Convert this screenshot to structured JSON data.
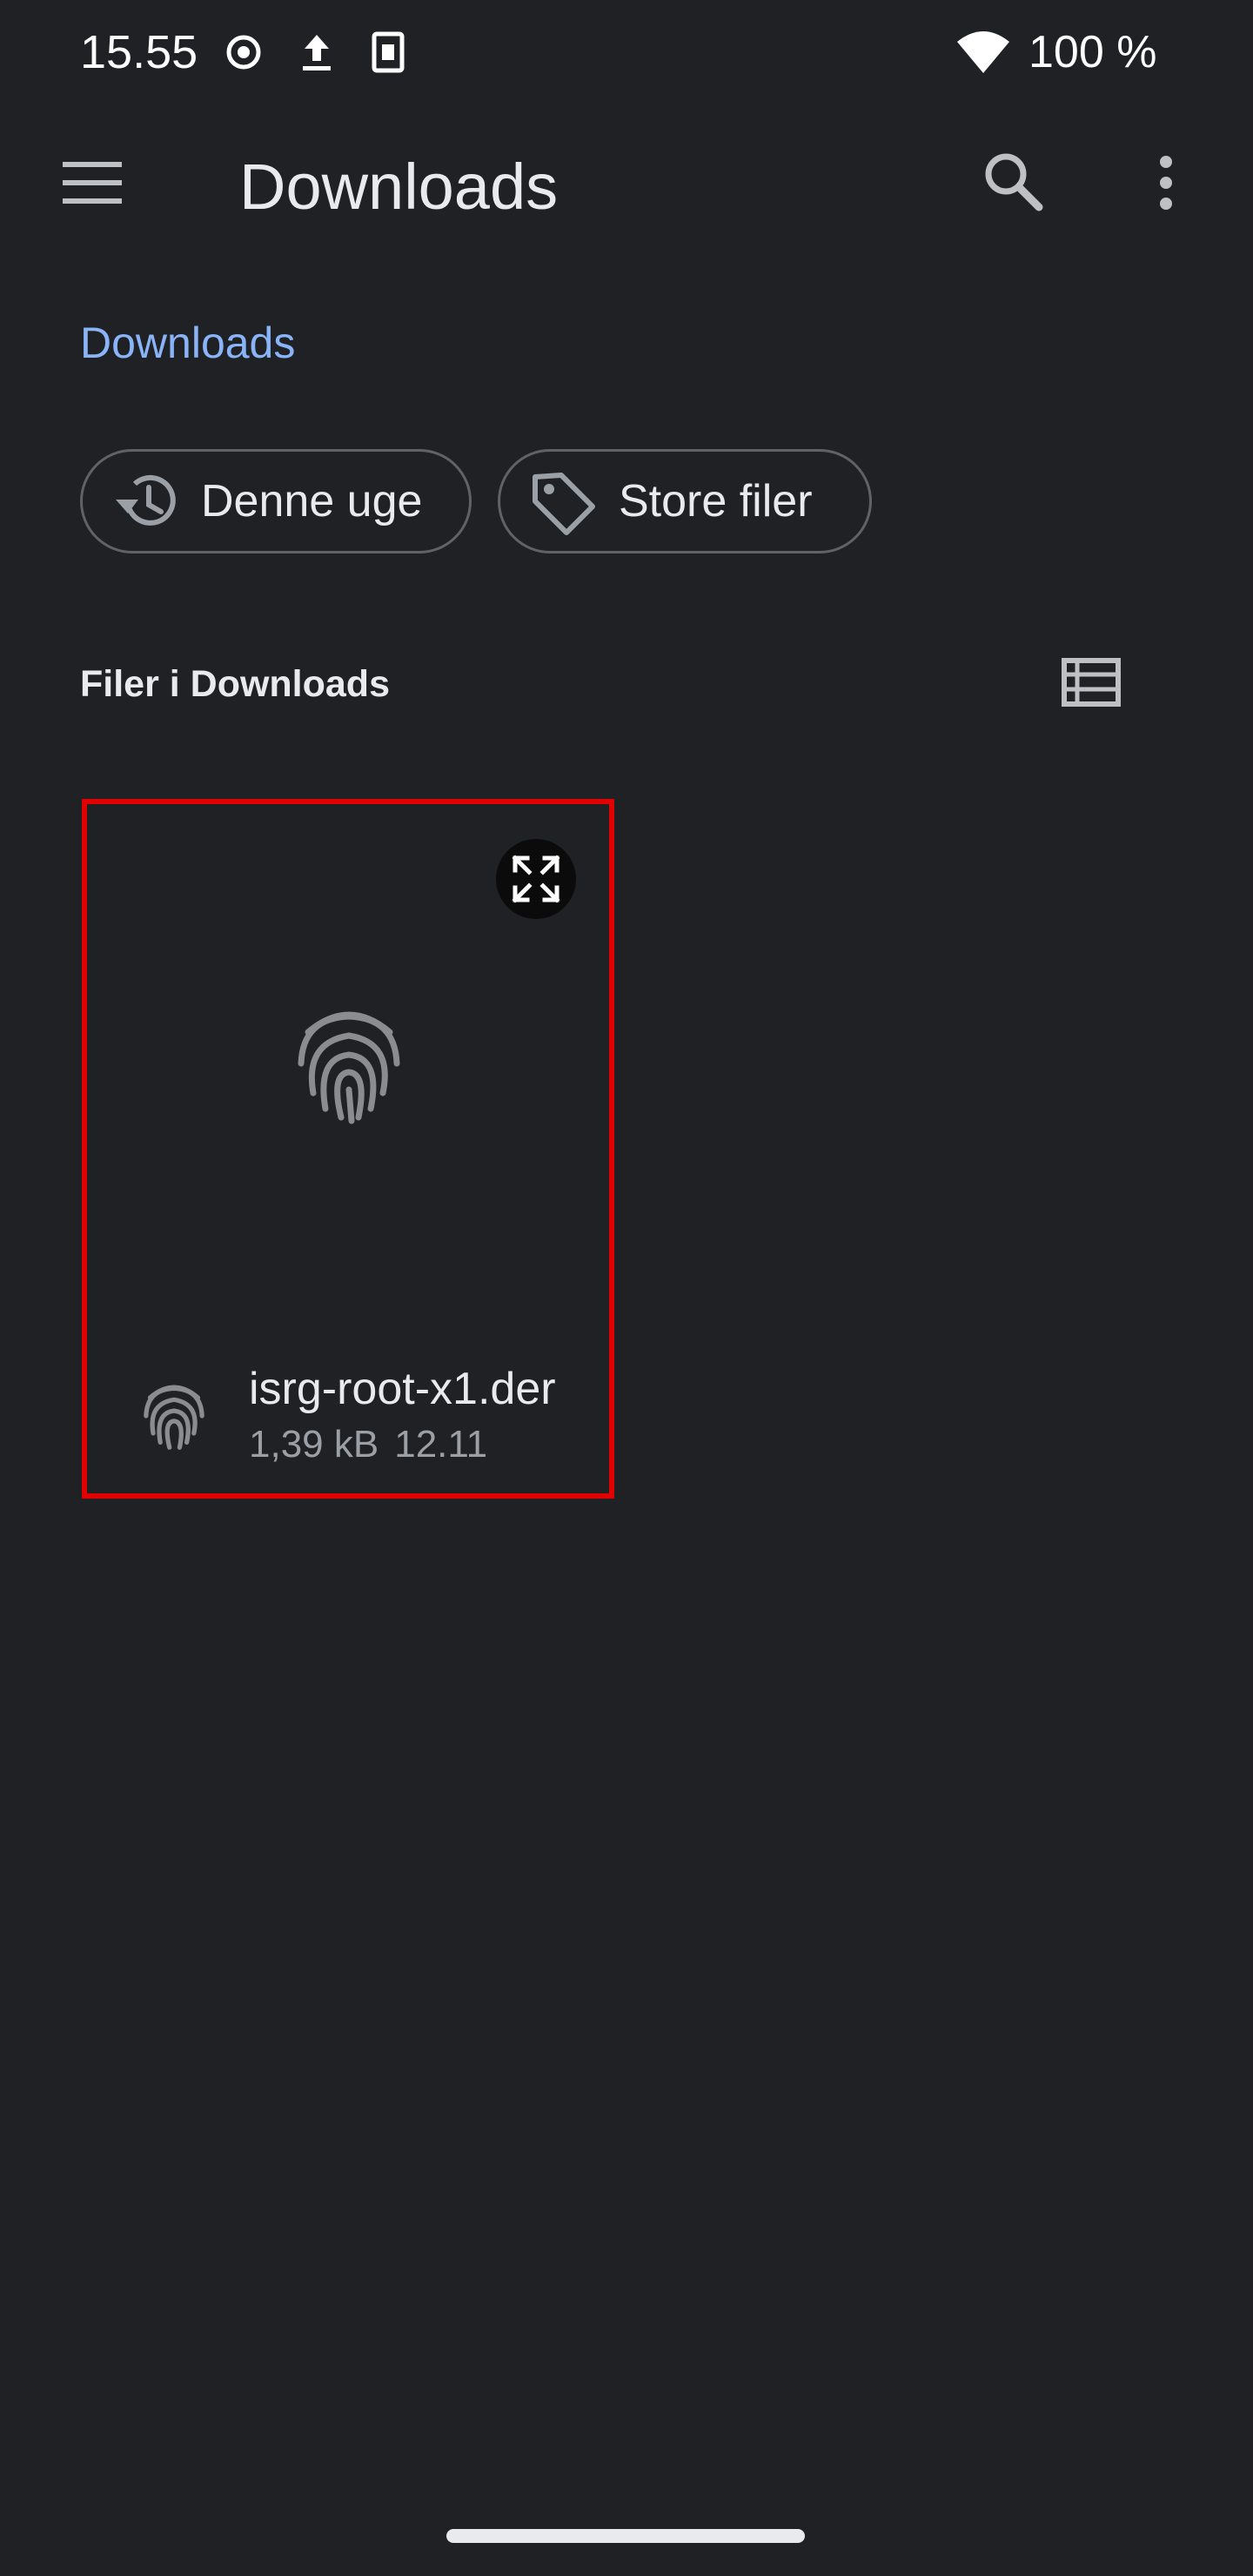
{
  "status_bar": {
    "time": "15.55",
    "battery": "100 %",
    "icons": [
      "record-icon",
      "upload-icon",
      "sim-card-icon",
      "wifi-icon"
    ]
  },
  "app_bar": {
    "title": "Downloads",
    "icons": [
      "menu-icon",
      "search-icon",
      "more-vert-icon"
    ]
  },
  "breadcrumb": {
    "label": "Downloads",
    "color": "#8ab4f8"
  },
  "chips": [
    {
      "label": "Denne uge",
      "icon": "history-icon"
    },
    {
      "label": "Store filer",
      "icon": "tag-icon"
    }
  ],
  "section": {
    "title": "Filer i Downloads",
    "view_toggle_icon": "list-view-icon"
  },
  "files": [
    {
      "name": "isrg-root-x1.der",
      "size": "1,39 kB",
      "date": "12.11",
      "thumbnail_icon": "fingerprint-icon",
      "type_icon": "fingerprint-icon",
      "expand_icon": "expand-icon",
      "highlight_color": "#e00000"
    }
  ],
  "colors": {
    "background": "#202124",
    "text_primary": "#e8eaed",
    "text_secondary": "#9aa0a6",
    "outline": "#5f6368"
  }
}
